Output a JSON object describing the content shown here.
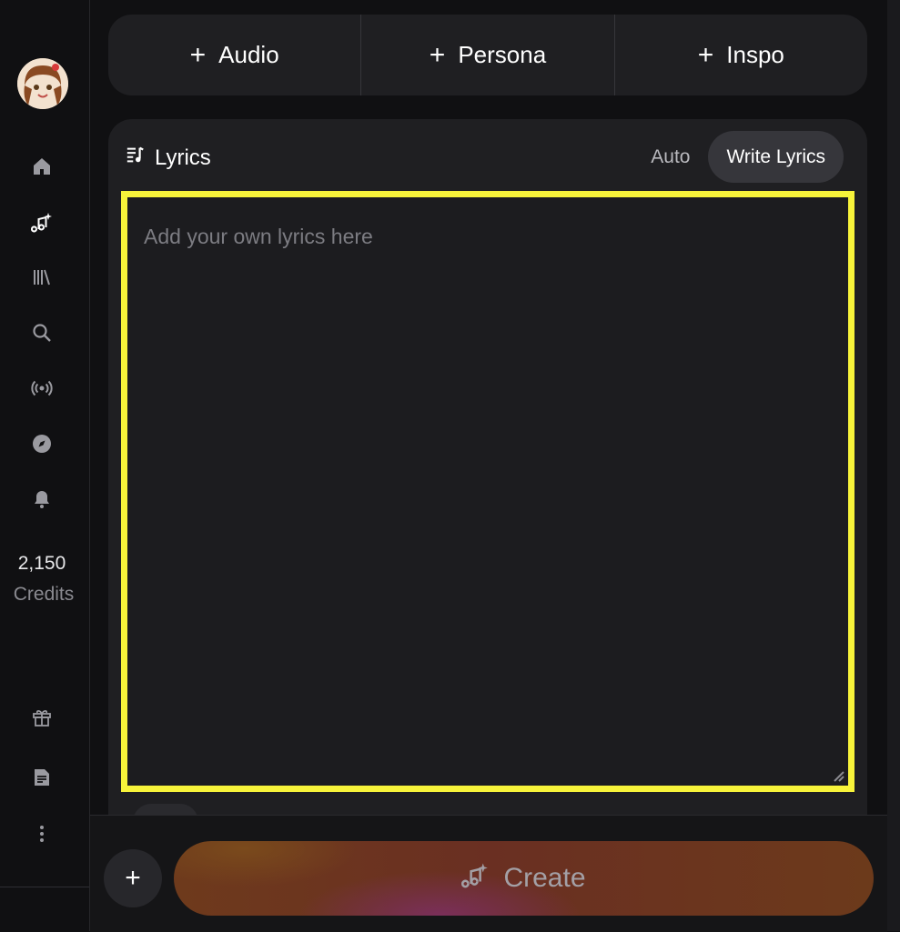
{
  "sidebar": {
    "credits_value": "2,150",
    "credits_label": "Credits",
    "nav_icons": [
      "home-icon",
      "create-icon",
      "library-icon",
      "search-icon",
      "radio-icon",
      "explore-icon",
      "notifications-icon",
      "gift-icon",
      "document-icon",
      "more-icon"
    ]
  },
  "add_bar": {
    "audio": "Audio",
    "persona": "Persona",
    "inspo": "Inspo"
  },
  "lyrics": {
    "title": "Lyrics",
    "tab_auto": "Auto",
    "tab_write": "Write Lyrics",
    "active_tab": "Write Lyrics",
    "placeholder": "Add your own lyrics here",
    "value": ""
  },
  "footer": {
    "create_label": "Create"
  },
  "colors": {
    "background": "#101012",
    "card": "#1f1f22",
    "highlight_border": "#f7f33a"
  }
}
